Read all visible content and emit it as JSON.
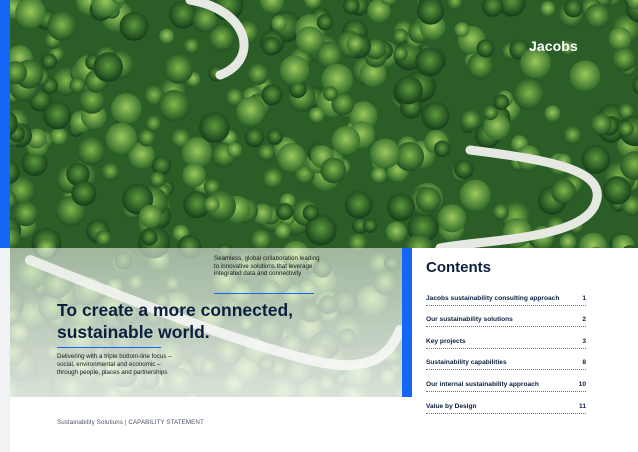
{
  "brand": {
    "logo": "Jacobs",
    "accent": "#1466f5",
    "navy": "#0b1f3f"
  },
  "hero": {
    "callout": "Seamless, global collaboration leading to innovative solutions that leverage integrated data and connectivity",
    "headline": "To create a more connected, sustainable world.",
    "subtext": "Delivering with a triple bottom-line focus – social, environmental and economic – through people, places and partnerships"
  },
  "contents": {
    "title": "Contents",
    "items": [
      {
        "label": "Jacobs sustainability consulting approach",
        "page": "1"
      },
      {
        "label": "Our sustainability solutions",
        "page": "2"
      },
      {
        "label": "Key projects",
        "page": "3"
      },
      {
        "label": "Sustainability capabilities",
        "page": "8"
      },
      {
        "label": "Our internal sustainability approach",
        "page": "10"
      },
      {
        "label": "Value by Design",
        "page": "11"
      }
    ]
  },
  "footer": {
    "text": "Sustainability Solutions  |  CAPABILITY STATEMENT"
  }
}
